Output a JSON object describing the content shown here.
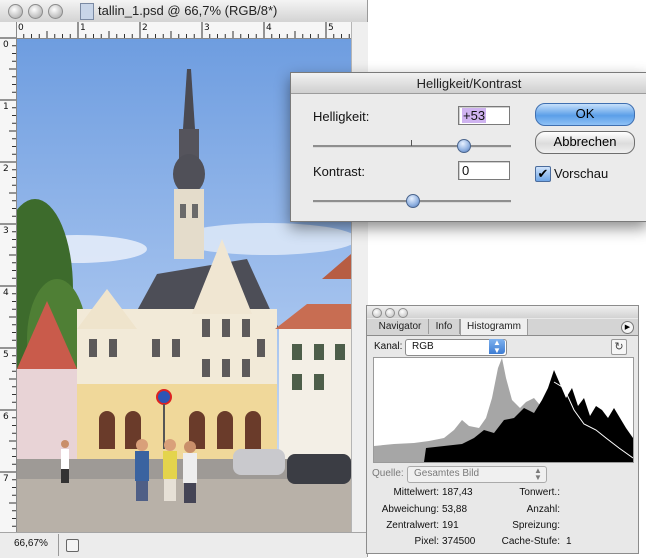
{
  "document": {
    "title": "tallin_1.psd @ 66,7% (RGB/8*)",
    "zoom": "66,67%",
    "ruler_top": [
      "0",
      "1",
      "2",
      "3",
      "4",
      "5"
    ],
    "ruler_left": [
      "0",
      "1",
      "2",
      "3",
      "4",
      "5",
      "6",
      "7"
    ]
  },
  "dialog": {
    "title": "Helligkeit/Kontrast",
    "brightness_label": "Helligkeit:",
    "brightness_value": "+53",
    "brightness_level": 0.76,
    "contrast_label": "Kontrast:",
    "contrast_value": "0",
    "contrast_level": 0.5,
    "ok_label": "OK",
    "cancel_label": "Abbrechen",
    "preview_label": "Vorschau",
    "preview_checked": true
  },
  "histogram_panel": {
    "tabs": [
      "Navigator",
      "Info",
      "Histogramm"
    ],
    "active_tab": "Histogramm",
    "channel_label": "Kanal:",
    "channel_value": "RGB",
    "source_label": "Quelle:",
    "source_value": "Gesamtes Bild",
    "stats_left": [
      {
        "label": "Mittelwert:",
        "value": "187,43"
      },
      {
        "label": "Abweichung:",
        "value": "53,88"
      },
      {
        "label": "Zentralwert:",
        "value": "191"
      },
      {
        "label": "Pixel:",
        "value": "374500"
      }
    ],
    "stats_right": [
      {
        "label": "Tonwert.:",
        "value": ""
      },
      {
        "label": "Anzahl:",
        "value": ""
      },
      {
        "label": "Spreizung:",
        "value": ""
      },
      {
        "label": "Cache-Stufe:",
        "value": "1"
      }
    ]
  },
  "colors": {
    "sky": "#7fa8e0",
    "dialog_bg": "#ebebeb",
    "accent_blue": "#5b9fe8",
    "brightness_field_highlight": "#cfb3f0"
  }
}
